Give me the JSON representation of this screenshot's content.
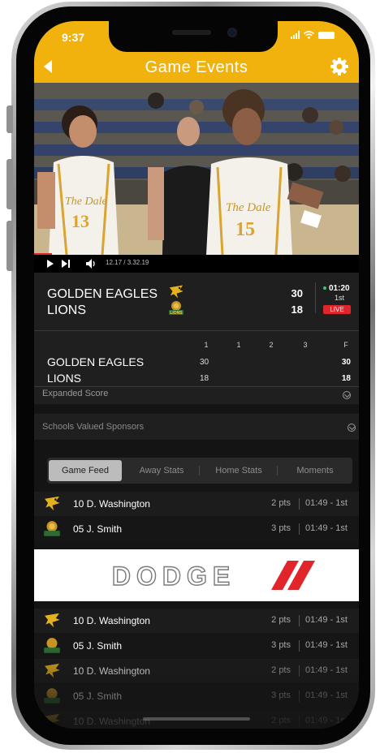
{
  "status_bar": {
    "time": "9:37"
  },
  "header": {
    "title": "Game Events"
  },
  "video": {
    "time_label": "12.17 / 3.32.19",
    "progress": 0.055
  },
  "scoreboard": {
    "home_team": "GOLDEN EAGLES",
    "away_team": "LIONS",
    "home_score": "30",
    "away_score": "18",
    "clock": "01:20",
    "period": "1st",
    "live_label": "LIVE",
    "period_headers": [
      "1",
      "1",
      "2",
      "3",
      "F"
    ],
    "home_periods": [
      "30",
      "",
      "",
      "",
      "30"
    ],
    "away_periods": [
      "18",
      "",
      "",
      "",
      "18"
    ],
    "expanded_label": "Expanded Score"
  },
  "sponsors": {
    "label": "Schools Valued Sponsors"
  },
  "tabs": [
    {
      "label": "Game Feed",
      "active": true
    },
    {
      "label": "Away Stats",
      "active": false
    },
    {
      "label": "Home Stats",
      "active": false
    },
    {
      "label": "Moments",
      "active": false
    }
  ],
  "feed_top": [
    {
      "team": "eagles",
      "player": "10 D. Washington",
      "points": "2 pts",
      "time": "01:49 - 1st"
    },
    {
      "team": "lions",
      "player": "05 J. Smith",
      "points": "3 pts",
      "time": "01:49 - 1st"
    }
  ],
  "ad": {
    "brand": "DODGE"
  },
  "feed_bottom": [
    {
      "team": "eagles",
      "player": "10 D. Washington",
      "points": "2 pts",
      "time": "01:49 - 1st"
    },
    {
      "team": "lions",
      "player": "05 J. Smith",
      "points": "3 pts",
      "time": "01:49 - 1st"
    },
    {
      "team": "eagles",
      "player": "10 D. Washington",
      "points": "2 pts",
      "time": "01:49 - 1st"
    },
    {
      "team": "lions",
      "player": "05 J. Smith",
      "points": "3 pts",
      "time": "01:49 - 1st"
    },
    {
      "team": "eagles",
      "player": "10 D. Washington",
      "points": "2 pts",
      "time": "01:49 - 1st"
    }
  ],
  "colors": {
    "accent": "#f1b20d",
    "live": "#e0262b",
    "background": "#141414",
    "panel": "#1f1f1f"
  },
  "icons": {
    "back": "back-arrow-icon",
    "settings": "gear-icon",
    "play": "play-icon",
    "next": "skip-next-icon",
    "volume": "volume-icon"
  }
}
